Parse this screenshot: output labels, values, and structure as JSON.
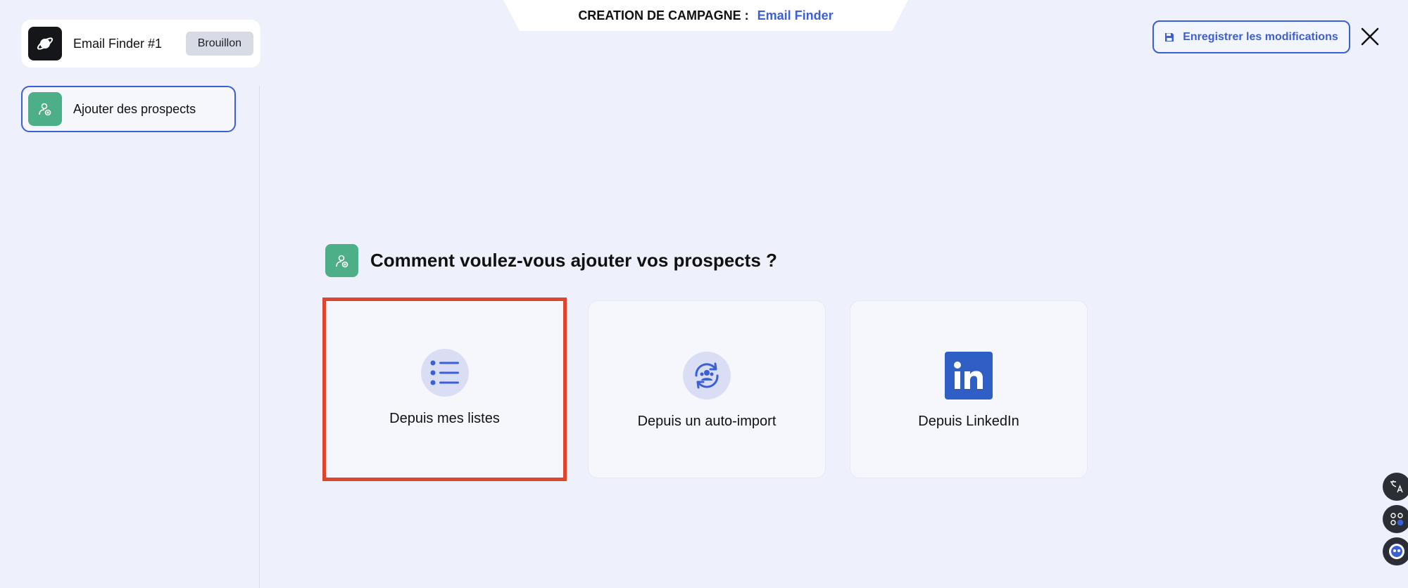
{
  "top_tab": {
    "label": "CREATION DE CAMPAGNE :",
    "value": "Email Finder"
  },
  "campaign": {
    "name": "Email Finder #1",
    "status": "Brouillon",
    "icon": "planet-icon"
  },
  "steps": [
    {
      "label": "Ajouter des prospects",
      "icon": "user-add-icon"
    }
  ],
  "header": {
    "save_label": "Enregistrer les modifications",
    "save_icon": "floppy-disk-icon",
    "close_icon": "close-icon"
  },
  "main": {
    "heading": "Comment voulez-vous ajouter vos prospects ?",
    "options": [
      {
        "label": "Depuis mes listes",
        "icon": "list-icon",
        "selected": true
      },
      {
        "label": "Depuis un auto-import",
        "icon": "auto-import-icon",
        "selected": false
      },
      {
        "label": "Depuis LinkedIn",
        "icon": "linkedin-icon",
        "selected": false
      }
    ]
  },
  "floating_buttons": [
    "translate-icon",
    "apps-icon",
    "chat-bot-icon"
  ],
  "colors": {
    "accent": "#3b5fd9",
    "green": "#4caf87",
    "highlight": "#e0452b",
    "background": "#eef0fb"
  }
}
